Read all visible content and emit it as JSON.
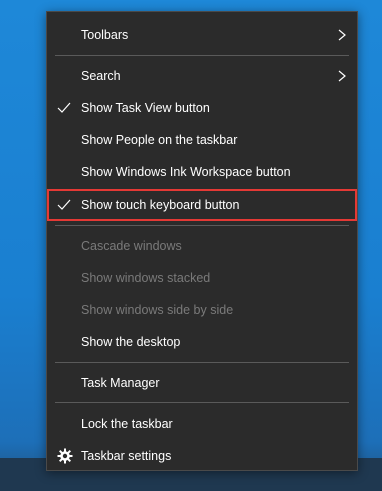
{
  "menu": {
    "items": [
      {
        "label": "Toolbars",
        "checked": false,
        "submenu": true,
        "disabled": false
      },
      {
        "label": "Search",
        "checked": false,
        "submenu": true,
        "disabled": false
      },
      {
        "label": "Show Task View button",
        "checked": true,
        "submenu": false,
        "disabled": false
      },
      {
        "label": "Show People on the taskbar",
        "checked": false,
        "submenu": false,
        "disabled": false
      },
      {
        "label": "Show Windows Ink Workspace button",
        "checked": false,
        "submenu": false,
        "disabled": false
      },
      {
        "label": "Show touch keyboard button",
        "checked": true,
        "submenu": false,
        "disabled": false,
        "highlighted": true
      },
      {
        "label": "Cascade windows",
        "checked": false,
        "submenu": false,
        "disabled": true
      },
      {
        "label": "Show windows stacked",
        "checked": false,
        "submenu": false,
        "disabled": true
      },
      {
        "label": "Show windows side by side",
        "checked": false,
        "submenu": false,
        "disabled": true
      },
      {
        "label": "Show the desktop",
        "checked": false,
        "submenu": false,
        "disabled": false
      },
      {
        "label": "Task Manager",
        "checked": false,
        "submenu": false,
        "disabled": false
      },
      {
        "label": "Lock the taskbar",
        "checked": false,
        "submenu": false,
        "disabled": false
      },
      {
        "label": "Taskbar settings",
        "checked": false,
        "submenu": false,
        "disabled": false,
        "icon": "gear-icon"
      }
    ]
  },
  "colors": {
    "menu_bg": "#2b2b2b",
    "text": "#ffffff",
    "disabled_text": "#7a7a7a",
    "highlight_border": "#e53935",
    "desktop_bg": "#1e88d8"
  }
}
